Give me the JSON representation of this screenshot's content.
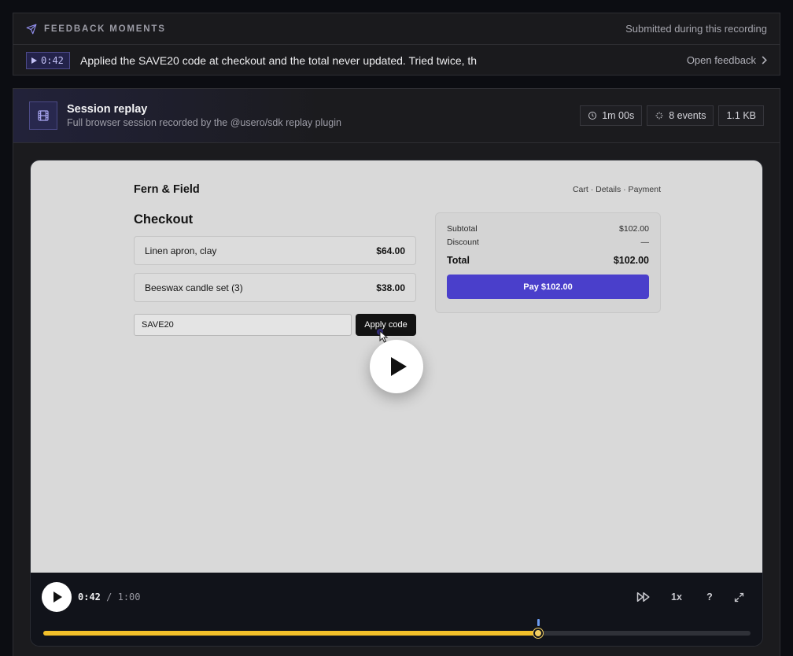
{
  "feedback": {
    "title": "FEEDBACK MOMENTS",
    "subtitle": "Submitted during this recording",
    "moment": {
      "timestamp": "0:42",
      "text": "Applied the SAVE20 code at checkout and the total never updated. Tried twice, th",
      "open_label": "Open feedback"
    }
  },
  "replay": {
    "title": "Session replay",
    "description": "Full browser session recorded by the @usero/sdk replay plugin",
    "stats": {
      "duration": "1m 00s",
      "events": "8 events",
      "size": "1.1 KB"
    }
  },
  "site": {
    "brand": "Fern & Field",
    "steps": "Cart · Details · Payment",
    "checkout_title": "Checkout",
    "items": [
      {
        "name": "Linen apron, clay",
        "price": "$64.00"
      },
      {
        "name": "Beeswax candle set (3)",
        "price": "$38.00"
      }
    ],
    "promo_value": "SAVE20",
    "apply_label": "Apply code",
    "summary": {
      "subtotal_label": "Subtotal",
      "subtotal_value": "$102.00",
      "discount_label": "Discount",
      "discount_value": "—",
      "total_label": "Total",
      "total_value": "$102.00",
      "pay_label": "Pay $102.00"
    }
  },
  "player": {
    "current_time": "0:42",
    "separator": "/",
    "duration": "1:00",
    "speed": "1x",
    "help": "?",
    "progress": 0.7,
    "marker_position": 0.7,
    "progress_color": "#f2c02a",
    "marker_color": "#6b9bf0",
    "icons": {
      "play": "play-icon",
      "skip": "skip-inactivity-icon",
      "fullscreen": "fullscreen-icon"
    }
  },
  "colors": {
    "accent": "#4a3fcb",
    "background": "#0c0d12"
  }
}
